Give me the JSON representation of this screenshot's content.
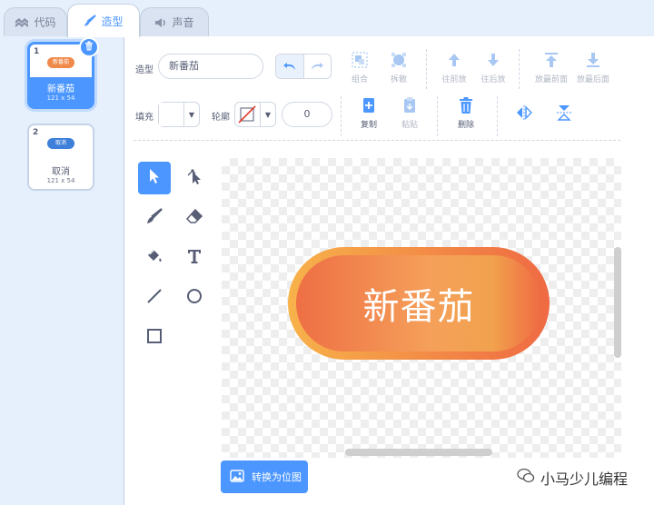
{
  "tabs": [
    {
      "label": "代码",
      "icon": "code-icon"
    },
    {
      "label": "造型",
      "icon": "brush-icon"
    },
    {
      "label": "声音",
      "icon": "speaker-icon"
    }
  ],
  "costumes": [
    {
      "number": "1",
      "thumb_text": "新番茄",
      "name": "新番茄",
      "size": "121 x 54",
      "thumb_color": "#f08a4b"
    },
    {
      "number": "2",
      "thumb_text": "取消",
      "name": "取消",
      "size": "121 x 54",
      "thumb_color": "#3d7fd9"
    }
  ],
  "toolbar": {
    "costume_label": "造型",
    "costume_name": "新番茄",
    "group": "组合",
    "ungroup": "拆散",
    "forward": "往前放",
    "backward": "往后放",
    "front": "放最前面",
    "back": "放最后面",
    "fill_label": "填充",
    "outline_label": "轮廓",
    "outline_width": "0",
    "copy": "复制",
    "paste": "粘贴",
    "delete": "删除"
  },
  "canvas": {
    "button_text": "新番茄"
  },
  "convert_button": "转换为位图",
  "watermark": "小马少儿编程",
  "colors": {
    "accent": "#4c97ff",
    "button_orange": "#ef6a43",
    "button_light": "#f7b24a"
  }
}
